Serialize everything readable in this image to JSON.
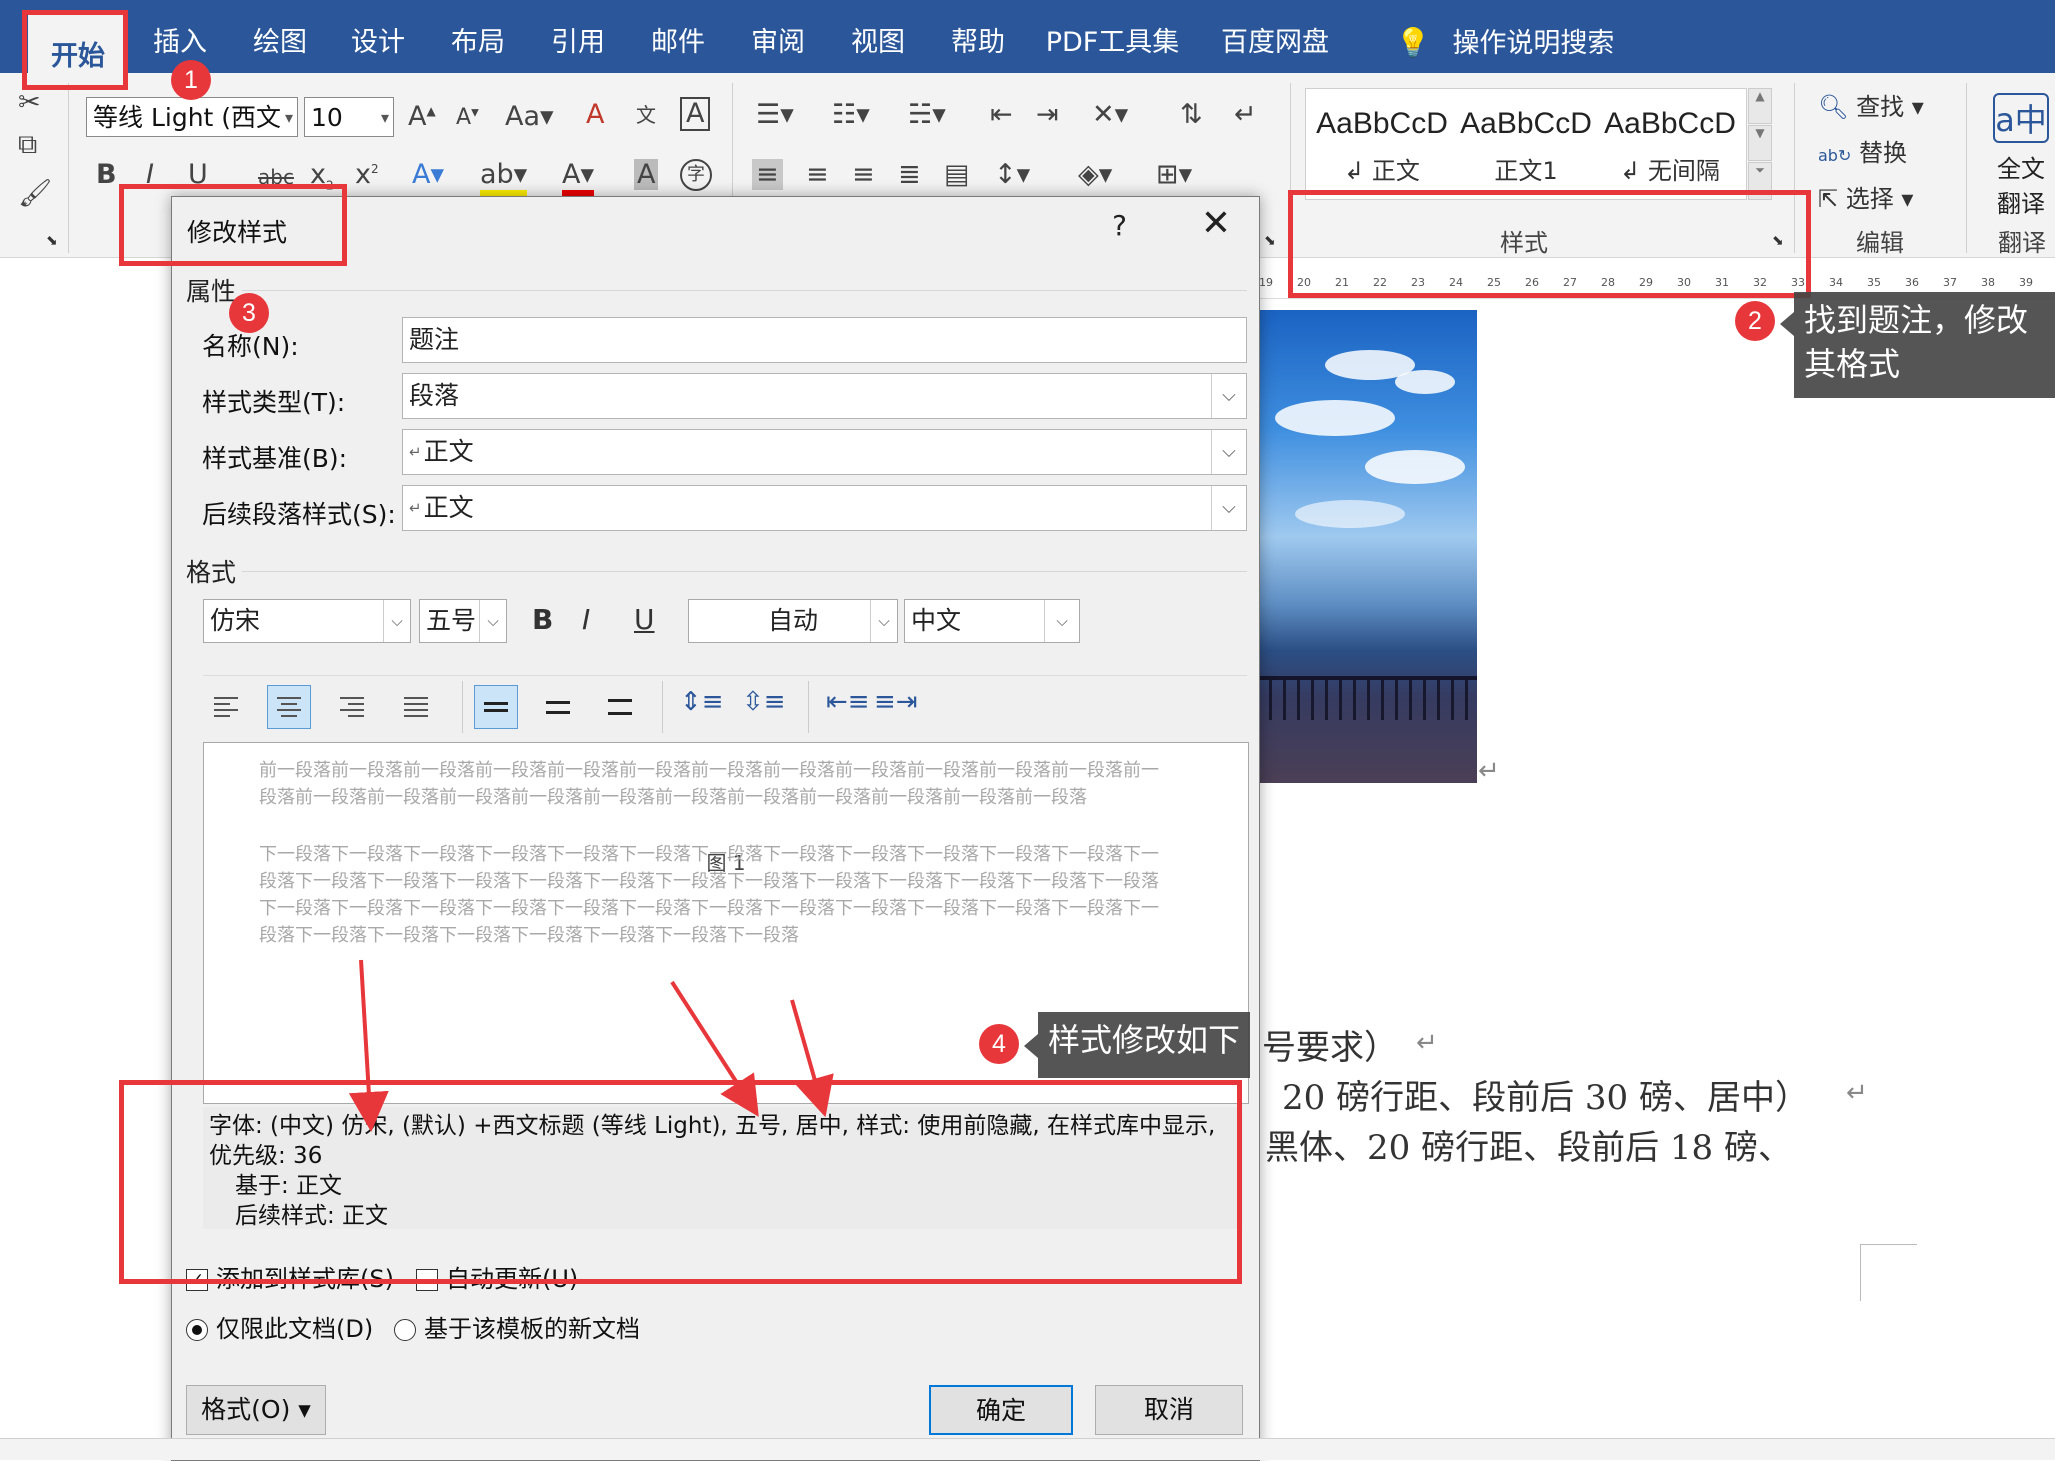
{
  "tabs": [
    "开始",
    "插入",
    "绘图",
    "设计",
    "布局",
    "引用",
    "邮件",
    "审阅",
    "视图",
    "帮助",
    "PDF工具集",
    "百度网盘",
    "操作说明搜索"
  ],
  "font_name": "等线 Light (西文",
  "font_size": "10",
  "styles_gallery": [
    {
      "sample": "AaBbCcD",
      "label": "正文"
    },
    {
      "sample": "AaBbCcD",
      "label": "正文1"
    },
    {
      "sample": "AaBbCcD",
      "label": "无间隔"
    }
  ],
  "ribbon_groups": {
    "styles": "样式",
    "edit": "编辑",
    "translate": "翻译"
  },
  "edit_items": {
    "find": "查找",
    "replace": "替换",
    "select": "选择"
  },
  "translate_label": [
    "全文",
    "翻译"
  ],
  "ruler_ticks": [
    "19",
    "20",
    "21",
    "22",
    "23",
    "24",
    "25",
    "26",
    "27",
    "28",
    "29",
    "30",
    "31",
    "32",
    "33",
    "34",
    "35",
    "36",
    "37",
    "38",
    "39"
  ],
  "dialog": {
    "title": "修改样式",
    "help": "?",
    "close": "✕",
    "properties_section": "属性",
    "name_label": "名称(N):",
    "name_value": "题注",
    "style_type_label": "样式类型(T):",
    "style_type_value": "段落",
    "based_on_label": "样式基准(B):",
    "based_on_value": "正文",
    "next_style_label": "后续段落样式(S):",
    "next_style_value": "正文",
    "format_section": "格式",
    "font": "仿宋",
    "size": "五号",
    "color": "自动",
    "script": "中文",
    "preview_prev": "前一段落前一段落前一段落前一段落前一段落前一段落前一段落前一段落前一段落前一段落前一段落前一段落前一段落前一段落前一段落前一段落前一段落前一段落前一段落前一段落前一段落前一段落前一段落前一段落",
    "preview_caption": "图 1",
    "preview_next": "下一段落下一段落下一段落下一段落下一段落下一段落下一段落下一段落下一段落下一段落下一段落下一段落下一段落下一段落下一段落下一段落下一段落下一段落下一段落下一段落下一段落下一段落下一段落下一段落下一段落下一段落下一段落下一段落下一段落下一段落下一段落下一段落下一段落下一段落下一段落下一段落下一段落下一段落下一段落下一段落下一段落下一段落下一段落下一段落下一段落",
    "description_line1": "字体: (中文) 仿宋, (默认) +西文标题 (等线 Light), 五号, 居中, 样式: 使用前隐藏, 在样式库中显示,",
    "description_line2": "优先级: 36",
    "description_line3": "基于: 正文",
    "description_line4": "后续样式: 正文",
    "add_to_gallery": "添加到样式库(S)",
    "auto_update": "自动更新(U)",
    "only_this_doc": "仅限此文档(D)",
    "new_docs_template": "基于该模板的新文档",
    "format_button": "格式(O)",
    "ok_button": "确定",
    "cancel_button": "取消"
  },
  "document_lines": [
    "号要求）",
    "20 磅行距、段前后 30 磅、居中）",
    "黑体、20 磅行距、段前后 18 磅、"
  ],
  "annotations": {
    "badge1": "1",
    "badge2": "2",
    "badge3": "3",
    "badge4": "4",
    "callout2": "找到题注，修改其格式",
    "callout4": "样式修改如下"
  },
  "colors": {
    "accent": "#2b579a",
    "annotation_red": "#e8373b",
    "callout_bg": "#464646"
  }
}
